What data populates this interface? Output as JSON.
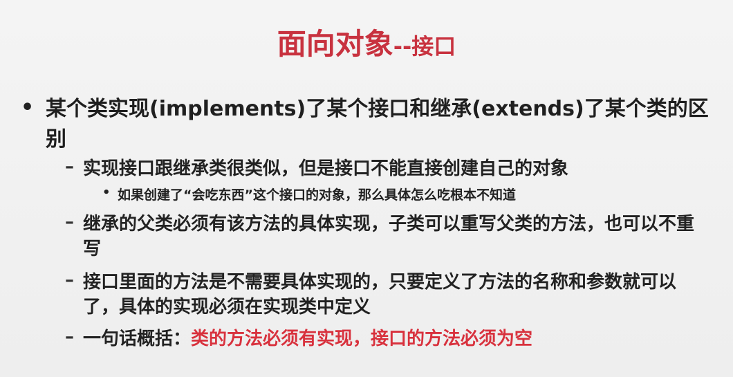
{
  "slide": {
    "title_main": "面向对象",
    "title_sub": "--接口",
    "bullet_char": "•",
    "dash_char": "–",
    "point": "某个类实现(implements)了某个接口和继承(extends)了某个类的区别",
    "sub_points": [
      "实现接口跟继承类很类似，但是接口不能直接创建自己的对象",
      "继承的父类必须有该方法的具体实现，子类可以重写父类的方法，也可以不重写",
      "接口里面的方法是不需要具体实现的，只要定义了方法的名称和参数就可以了，具体的实现必须在实现类中定义"
    ],
    "sub_sub_point": "如果创建了“会吃东西”这个接口的对象，那么具体怎么吃根本不知道",
    "summary_label": "一句话概括：",
    "summary_highlight": "类的方法必须有实现，接口的方法必须为空",
    "colors": {
      "title": "#c8323f",
      "highlight": "#d8313d",
      "text": "#222222",
      "background": "#f1f1f1"
    }
  }
}
